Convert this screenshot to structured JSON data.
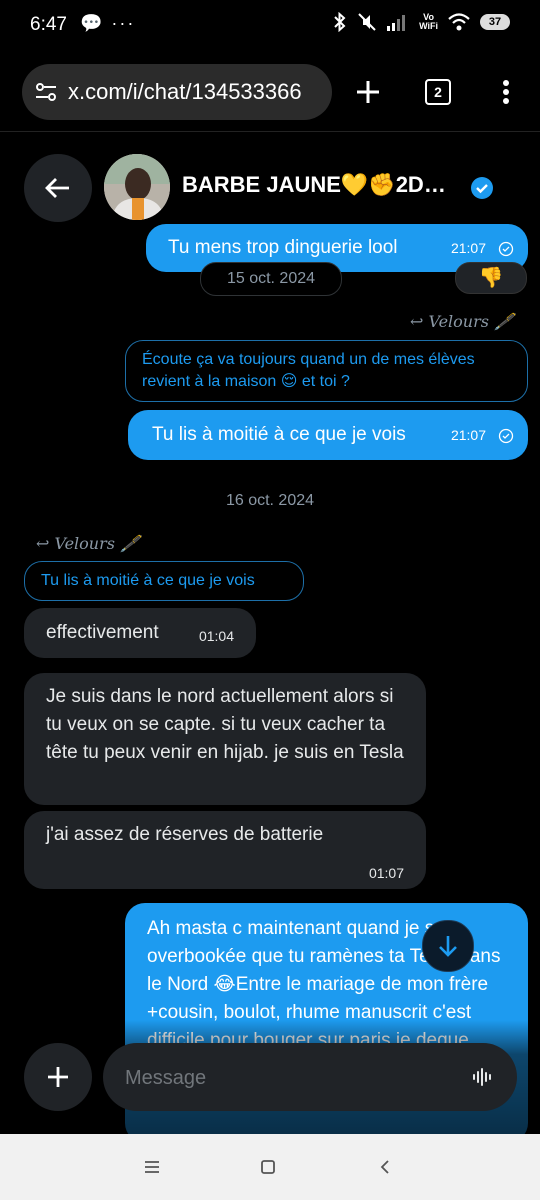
{
  "status_bar": {
    "time": "6:47",
    "left_icons": "💬 ···",
    "wifi_label_top": "Vo",
    "wifi_label_bottom": "WiFi",
    "battery": "37"
  },
  "browser": {
    "url": "x.com/i/chat/134533366",
    "tab_count": "2"
  },
  "header": {
    "name": "BARBE JAUNE💛✊2D…"
  },
  "messages": {
    "m1": {
      "text": "Tu mens trop  dinguerie lool",
      "time": "21:07",
      "reaction": "👎"
    },
    "date1": "15 oct. 2024",
    "reply1_label": "Velours 🖋️",
    "m2_quote": "Écoute ça va toujours quand un de mes élèves revient à la maison 😌 et toi ?",
    "m2": {
      "text": "Tu lis à moitié à ce que je vois",
      "time": "21:07"
    },
    "date2": "16 oct. 2024",
    "reply2_label": "Velours 🖋️",
    "m3_quote": "Tu lis à moitié à ce que je vois",
    "m3": {
      "text": "effectivement",
      "time": "01:04"
    },
    "m4": {
      "text": "Je suis dans le nord actuellement alors si tu veux on se capte. si tu veux cacher ta tête tu peux venir en hijab. je suis en Tesla"
    },
    "m5": {
      "text": "j'ai assez de réserves de batterie",
      "time": "01:07"
    },
    "m6": {
      "text": "Ah masta c maintenant quand je suis overbookée que tu ramènes ta Tesla dans le Nord 😂Entre le mariage de mon frère +cousin, boulot, rhume manuscrit c'est difficile pour bouger sur paris je deque même d'ly"
    }
  },
  "composer": {
    "placeholder": "Message"
  },
  "colors": {
    "accent": "#1d9bf0",
    "incoming_bubble": "#202327",
    "background": "#000000"
  }
}
